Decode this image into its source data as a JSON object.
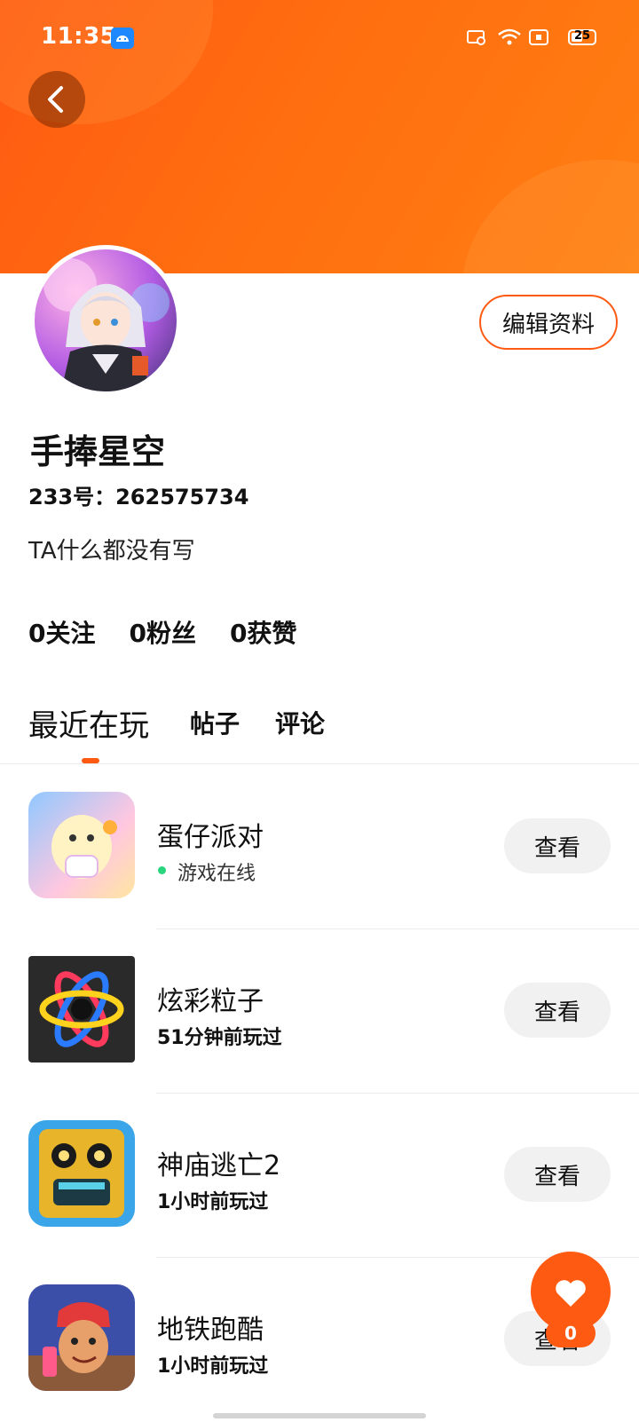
{
  "status_bar": {
    "time": "11:35",
    "battery": "25"
  },
  "profile": {
    "edit_label": "编辑资料",
    "username": "手捧星空",
    "uid": "233号：262575734",
    "bio": "TA什么都没有写",
    "stats": [
      {
        "label": "0关注"
      },
      {
        "label": "0粉丝"
      },
      {
        "label": "0获赞"
      }
    ]
  },
  "tabs": [
    {
      "label": "最近在玩",
      "active": true
    },
    {
      "label": "帖子",
      "active": false
    },
    {
      "label": "评论",
      "active": false
    }
  ],
  "games": [
    {
      "name": "蛋仔派对",
      "sub": "游戏在线",
      "online": true,
      "button": "查看",
      "icon": "eggy-party-icon"
    },
    {
      "name": "炫彩粒子",
      "sub": "51分钟前玩过",
      "online": false,
      "button": "查看",
      "icon": "colorful-particles-icon"
    },
    {
      "name": "神庙逃亡2",
      "sub": "1小时前玩过",
      "online": false,
      "button": "查看",
      "icon": "temple-run-2-icon"
    },
    {
      "name": "地铁跑酷",
      "sub": "1小时前玩过",
      "online": false,
      "button": "查看",
      "icon": "subway-surfers-icon"
    }
  ],
  "fab": {
    "count": "0",
    "icon": "heart-icon"
  },
  "colors": {
    "accent": "#ff5a12",
    "online": "#27d67c"
  }
}
